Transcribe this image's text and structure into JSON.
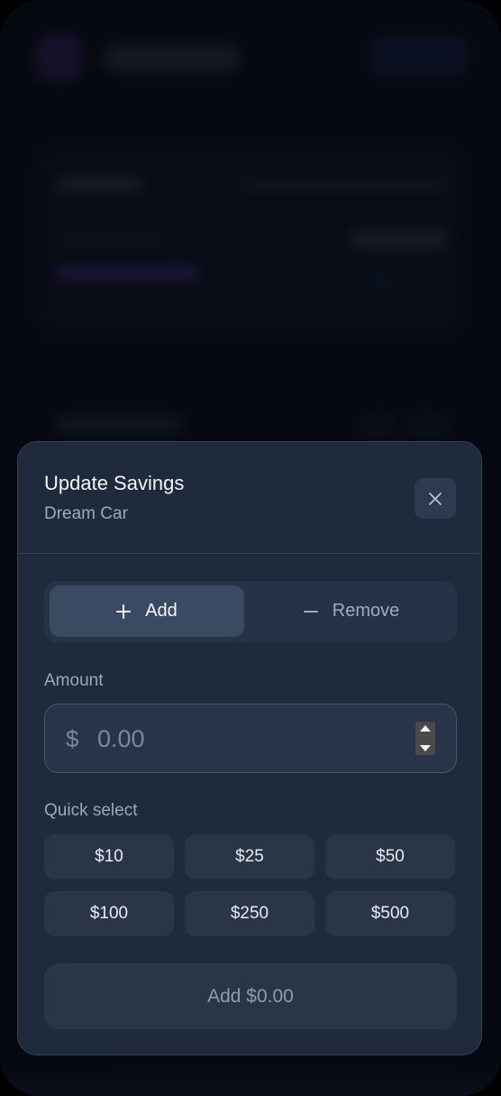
{
  "modal": {
    "title": "Update Savings",
    "subtitle": "Dream Car",
    "close_icon": "close-icon"
  },
  "mode_toggle": {
    "add_label": "Add",
    "add_icon": "plus-icon",
    "remove_label": "Remove",
    "remove_icon": "minus-icon",
    "selected": "Add"
  },
  "amount": {
    "label": "Amount",
    "currency_symbol": "$",
    "value": "",
    "placeholder": "0.00"
  },
  "quick_select": {
    "label": "Quick select",
    "options": [
      "$10",
      "$25",
      "$50",
      "$100",
      "$250",
      "$500"
    ]
  },
  "submit": {
    "label": "Add $0.00"
  },
  "colors": {
    "sheet_background": "#1f2a3d",
    "selected_toggle": "#3a4a63",
    "button_background": "#2a3548",
    "primary_text": "#f3f5f9",
    "secondary_text": "#9ea8ba"
  }
}
